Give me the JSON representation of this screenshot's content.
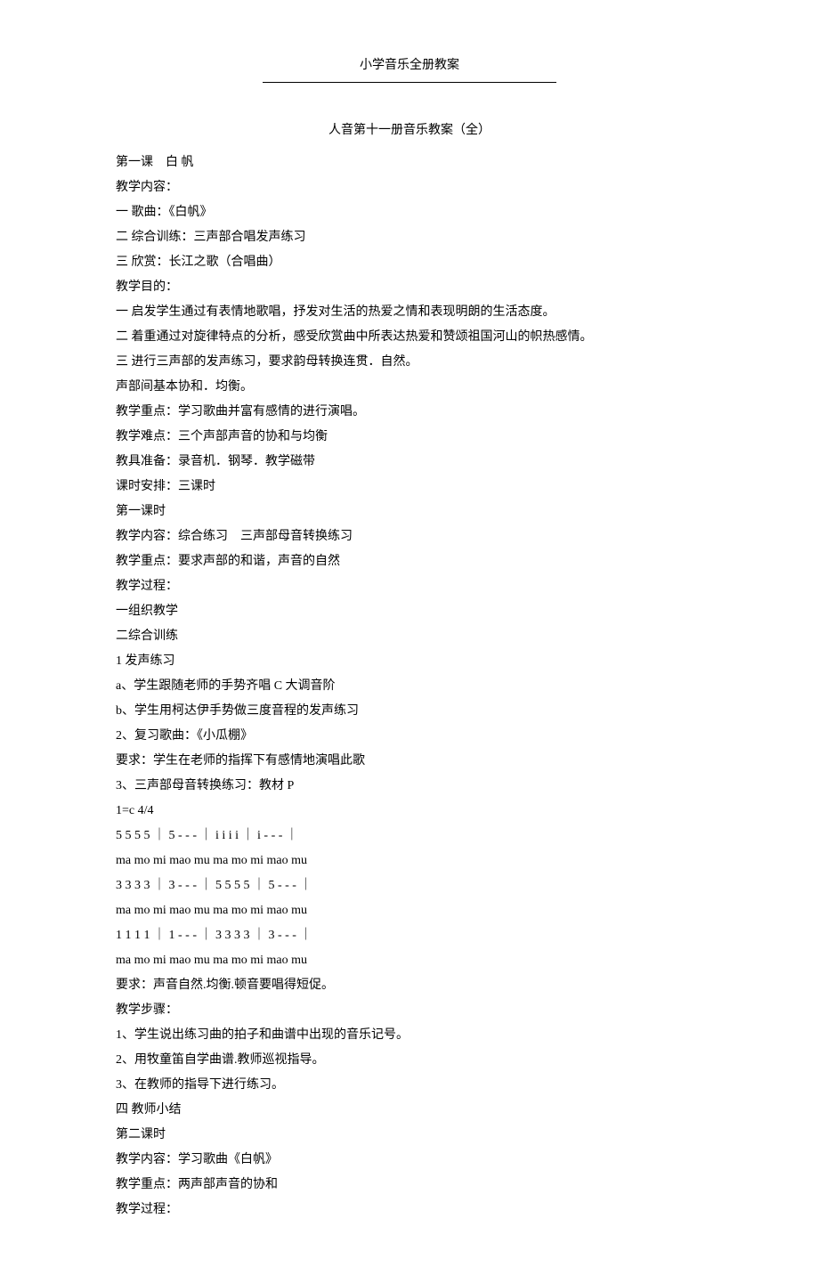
{
  "header": "小学音乐全册教案",
  "title": "人音第十一册音乐教案（全）",
  "lines": [
    "第一课　白 帆",
    "教学内容：",
    "一 歌曲：《白帆》",
    "二 综合训练：三声部合唱发声练习",
    "三 欣赏：长江之歌（合唱曲）",
    "教学目的：",
    "一 启发学生通过有表情地歌唱，抒发对生活的热爱之情和表现明朗的生活态度。",
    "二 着重通过对旋律特点的分析，感受欣赏曲中所表达热爱和赞颂祖国河山的帜热感情。",
    "三 进行三声部的发声练习，要求韵母转换连贯．自然。",
    "声部间基本协和．均衡。",
    "教学重点：学习歌曲并富有感情的进行演唱。",
    "教学难点：三个声部声音的协和与均衡",
    "教具准备：录音机．钢琴．教学磁带",
    "课时安排：三课时",
    "第一课时",
    "教学内容：综合练习　三声部母音转换练习",
    "教学重点：要求声部的和谐，声音的自然",
    "教学过程：",
    "一组织教学",
    "二综合训练",
    "1 发声练习",
    "a、学生跟随老师的手势齐唱 C 大调音阶",
    "b、学生用柯达伊手势做三度音程的发声练习",
    "2、复习歌曲：《小瓜棚》",
    "要求：学生在老师的指挥下有感情地演唱此歌",
    "3、三声部母音转换练习：教材 P",
    "1=c 4/4",
    "5 5 5 5 ｜ 5 - - - ｜ i i i i ｜ i - - - ｜",
    "ma mo mi mao mu ma mo mi mao mu",
    "3 3 3 3 ｜ 3 - - - ｜ 5 5 5 5 ｜ 5 - - - ｜",
    "ma mo mi mao mu ma mo mi mao mu",
    "1 1 1 1 ｜ 1 - - - ｜ 3 3 3 3 ｜ 3 - - - ｜",
    "ma mo mi mao mu ma mo mi mao mu",
    "要求：声音自然.均衡.顿音要唱得短促。",
    "教学步骤：",
    "1、学生说出练习曲的拍子和曲谱中出现的音乐记号。",
    "2、用牧童笛自学曲谱.教师巡视指导。",
    "3、在教师的指导下进行练习。",
    "四 教师小结",
    "第二课时",
    "教学内容：学习歌曲《白帆》",
    "教学重点：两声部声音的协和",
    "教学过程："
  ]
}
